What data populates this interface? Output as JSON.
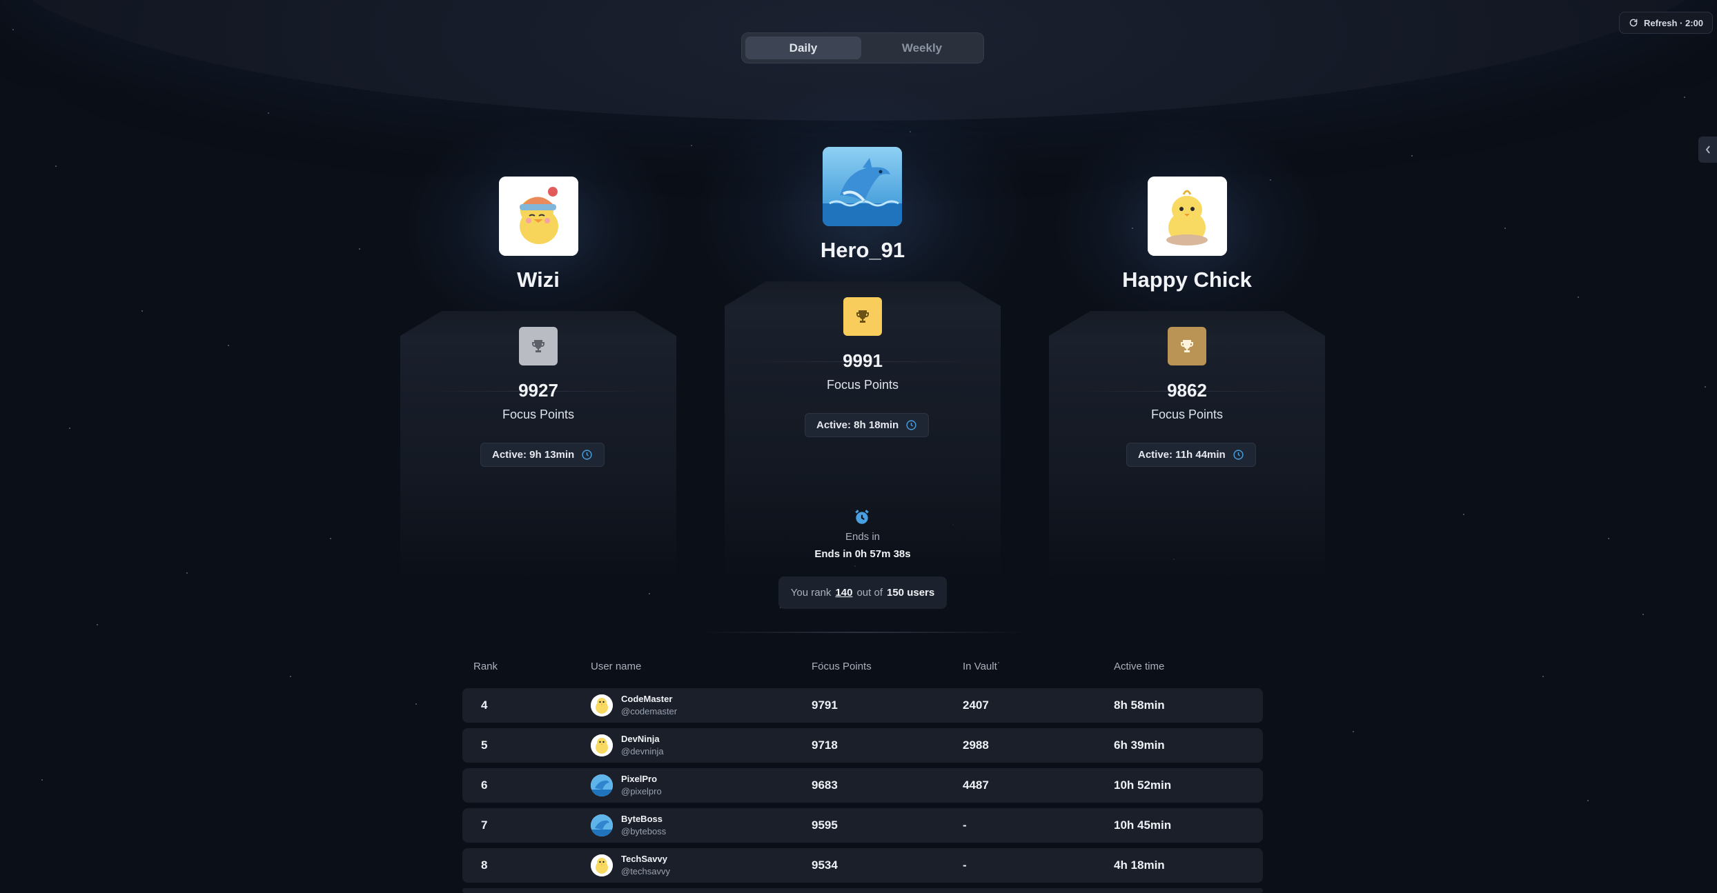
{
  "period_toggle": {
    "daily_label": "Daily",
    "weekly_label": "Weekly",
    "selected": "Daily"
  },
  "refresh": {
    "label": "Refresh · 2:00"
  },
  "podium": {
    "first": {
      "name": "Hero_91",
      "points": "9991",
      "points_label": "Focus Points",
      "active": "Active: 8h 18min",
      "trophy_color": "#f8cd5b",
      "avatar": "dolphin"
    },
    "second": {
      "name": "Wizi",
      "points": "9927",
      "points_label": "Focus Points",
      "active": "Active: 9h 13min",
      "trophy_color": "#b9bcc2",
      "avatar": "chick-with-hat"
    },
    "third": {
      "name": "Happy Chick",
      "points": "9862",
      "points_label": "Focus Points",
      "active": "Active: 11h 44min",
      "trophy_color": "#b99455",
      "avatar": "chick"
    }
  },
  "timer": {
    "label": "Ends in",
    "value": "Ends in 0h 57m 38s"
  },
  "user_rank": {
    "prefix": "You rank",
    "rank": "140",
    "middle": "out of",
    "total": "150 users"
  },
  "table": {
    "headers": {
      "rank": "Rank",
      "user": "User name",
      "points": "Focus Points",
      "vault": "In Vault",
      "active": "Active time"
    },
    "rows": [
      {
        "rank": "4",
        "name": "CodeMaster",
        "handle": "@codemaster",
        "points": "9791",
        "vault": "2407",
        "active": "8h 58min",
        "avatar": "chick"
      },
      {
        "rank": "5",
        "name": "DevNinja",
        "handle": "@devninja",
        "points": "9718",
        "vault": "2988",
        "active": "6h 39min",
        "avatar": "chick"
      },
      {
        "rank": "6",
        "name": "PixelPro",
        "handle": "@pixelpro",
        "points": "9683",
        "vault": "4487",
        "active": "10h 52min",
        "avatar": "dolphin"
      },
      {
        "rank": "7",
        "name": "ByteBoss",
        "handle": "@byteboss",
        "points": "9595",
        "vault": "-",
        "active": "10h 45min",
        "avatar": "dolphin"
      },
      {
        "rank": "8",
        "name": "TechSavvy",
        "handle": "@techsavvy",
        "points": "9534",
        "vault": "-",
        "active": "4h 18min",
        "avatar": "chick"
      }
    ]
  },
  "colors": {
    "background": "#0b0f17",
    "accent_blue": "#4a9fe0",
    "gold": "#f8cd5b",
    "silver": "#b9bcc2",
    "bronze": "#b99455"
  }
}
